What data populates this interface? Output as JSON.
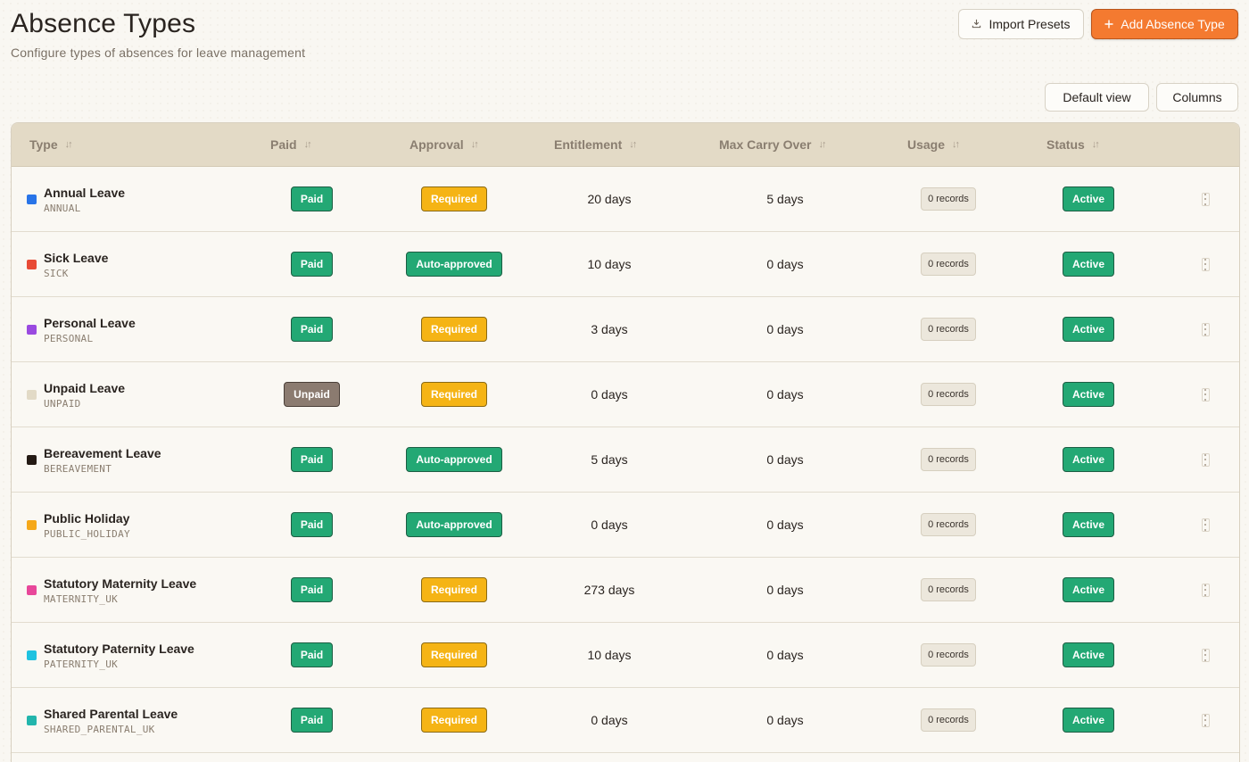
{
  "header": {
    "title": "Absence Types",
    "subtitle": "Configure types of absences for leave management"
  },
  "toolbar": {
    "import_label": "Import Presets",
    "import_icon": "download-icon",
    "add_label": "Add Absence Type",
    "add_icon": "plus-icon",
    "default_view_label": "Default view",
    "columns_label": "Columns"
  },
  "table": {
    "columns": {
      "type": "Type",
      "paid": "Paid",
      "approval": "Approval",
      "entitlement": "Entitlement",
      "max_carry_over": "Max Carry Over",
      "usage": "Usage",
      "status": "Status"
    },
    "rows": [
      {
        "name": "Annual Leave",
        "code": "ANNUAL",
        "color": "#2874e8",
        "paid": "Paid",
        "approval": "Required",
        "entitlement": "20 days",
        "carry": "5 days",
        "usage": "0 records",
        "status": "Active"
      },
      {
        "name": "Sick Leave",
        "code": "SICK",
        "color": "#e84a35",
        "paid": "Paid",
        "approval": "Auto-approved",
        "entitlement": "10 days",
        "carry": "0 days",
        "usage": "0 records",
        "status": "Active"
      },
      {
        "name": "Personal Leave",
        "code": "PERSONAL",
        "color": "#9a4ae0",
        "paid": "Paid",
        "approval": "Required",
        "entitlement": "3 days",
        "carry": "0 days",
        "usage": "0 records",
        "status": "Active"
      },
      {
        "name": "Unpaid Leave",
        "code": "UNPAID",
        "color": "#e2dac6",
        "paid": "Unpaid",
        "approval": "Required",
        "entitlement": "0 days",
        "carry": "0 days",
        "usage": "0 records",
        "status": "Active"
      },
      {
        "name": "Bereavement Leave",
        "code": "BEREAVEMENT",
        "color": "#241a14",
        "paid": "Paid",
        "approval": "Auto-approved",
        "entitlement": "5 days",
        "carry": "0 days",
        "usage": "0 records",
        "status": "Active"
      },
      {
        "name": "Public Holiday",
        "code": "PUBLIC_HOLIDAY",
        "color": "#f5a81a",
        "paid": "Paid",
        "approval": "Auto-approved",
        "entitlement": "0 days",
        "carry": "0 days",
        "usage": "0 records",
        "status": "Active"
      },
      {
        "name": "Statutory Maternity Leave",
        "code": "MATERNITY_UK",
        "color": "#e8479a",
        "paid": "Paid",
        "approval": "Required",
        "entitlement": "273 days",
        "carry": "0 days",
        "usage": "0 records",
        "status": "Active"
      },
      {
        "name": "Statutory Paternity Leave",
        "code": "PATERNITY_UK",
        "color": "#1ec2e0",
        "paid": "Paid",
        "approval": "Required",
        "entitlement": "10 days",
        "carry": "0 days",
        "usage": "0 records",
        "status": "Active"
      },
      {
        "name": "Shared Parental Leave",
        "code": "SHARED_PARENTAL_UK",
        "color": "#22b5ac",
        "paid": "Paid",
        "approval": "Required",
        "entitlement": "0 days",
        "carry": "0 days",
        "usage": "0 records",
        "status": "Active"
      }
    ]
  }
}
